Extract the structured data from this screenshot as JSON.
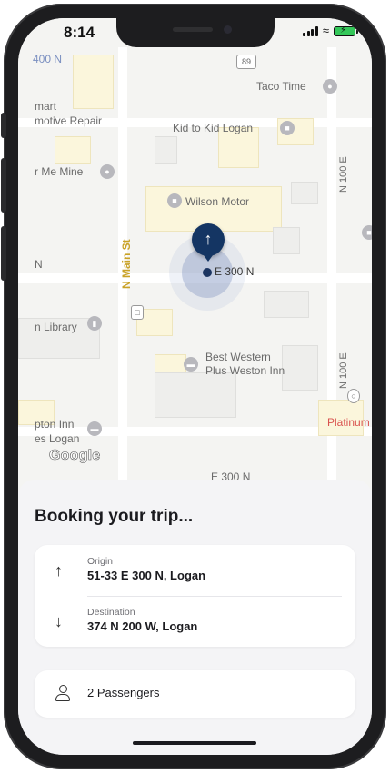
{
  "status_bar": {
    "time": "8:14"
  },
  "map": {
    "labels": {
      "top_left": "400 N",
      "taco_time": "Taco Time",
      "mart": "mart",
      "motive_repair": "motive Repair",
      "kid_to_kid": "Kid to Kid Logan",
      "n100e_top": "N 100 E",
      "or_me_mine": "r Me Mine",
      "wilson_motor": "Wilson Motor",
      "n_main_st": "N Main St",
      "n_left": "N",
      "location": "E 300 N",
      "library": "n Library",
      "best_western_1": "Best Western",
      "best_western_2": "Plus Weston Inn",
      "n100e_bottom": "N 100 E",
      "platinum": "Platinum I",
      "hampton_1": "pton Inn",
      "hampton_2": "es Logan",
      "bottom_street": "E 300 N",
      "route_shield": "89",
      "google": "Google"
    }
  },
  "booking": {
    "title": "Booking your trip...",
    "origin": {
      "label": "Origin",
      "value": "51-33 E 300 N, Logan"
    },
    "destination": {
      "label": "Destination",
      "value": "374 N 200 W, Logan"
    },
    "passengers": "2 Passengers"
  },
  "colors": {
    "pin": "#143563",
    "platinum_label": "#d9534f",
    "street_yellow": "#c9a227"
  }
}
